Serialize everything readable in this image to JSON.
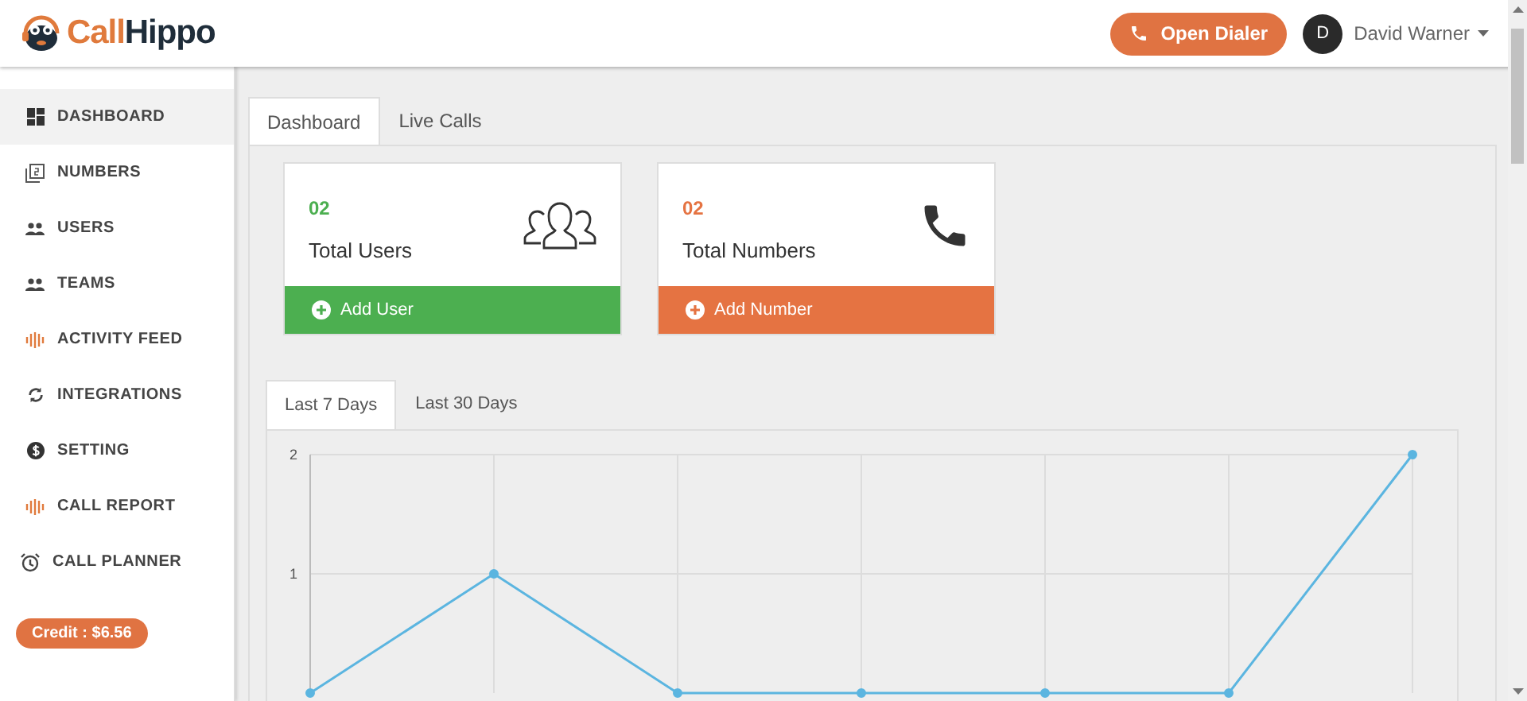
{
  "header": {
    "brand": {
      "part_1": "Call",
      "part_2": "Hippo"
    },
    "dialer_button": "Open Dialer",
    "user": {
      "initial": "D",
      "name": "David Warner"
    }
  },
  "sidebar": {
    "items": [
      {
        "label": "DASHBOARD",
        "selected": true
      },
      {
        "label": "NUMBERS",
        "selected": false
      },
      {
        "label": "USERS",
        "selected": false
      },
      {
        "label": "TEAMS",
        "selected": false
      },
      {
        "label": "ACTIVITY FEED",
        "selected": false
      },
      {
        "label": "INTEGRATIONS",
        "selected": false
      },
      {
        "label": "SETTING",
        "selected": false
      },
      {
        "label": "CALL REPORT",
        "selected": false
      },
      {
        "label": "CALL PLANNER",
        "selected": false
      }
    ],
    "credit": "Credit : $6.56"
  },
  "tabs": [
    {
      "label": "Dashboard",
      "selected": true
    },
    {
      "label": "Live Calls",
      "selected": false
    }
  ],
  "cards": [
    {
      "count": "02",
      "label": "Total Users",
      "action": "Add User",
      "color": "#4caf50"
    },
    {
      "count": "02",
      "label": "Total Numbers",
      "action": "Add Number",
      "color": "#e57342"
    }
  ],
  "range_tabs": [
    {
      "label": "Last 7 Days",
      "selected": true
    },
    {
      "label": "Last 30 Days",
      "selected": false
    }
  ],
  "chart_data": {
    "type": "line",
    "ylim": [
      0,
      2
    ],
    "yticks": [
      1,
      2
    ],
    "grid": true,
    "series": [
      {
        "color": "#5bb5e0",
        "marker": "circle",
        "values": [
          0,
          1,
          0,
          0,
          0,
          0,
          2
        ]
      }
    ]
  }
}
